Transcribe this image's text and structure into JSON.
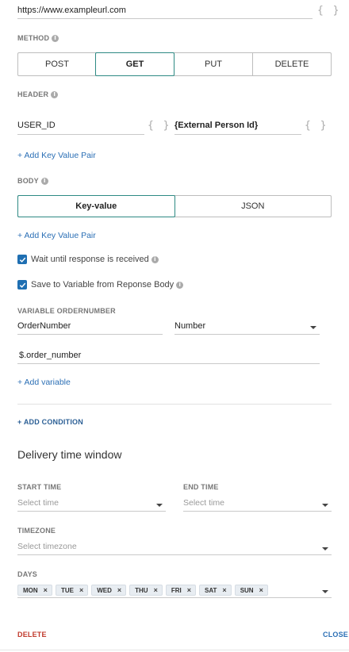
{
  "url": {
    "value": "https://www.exampleurl.com",
    "braces": "{ }"
  },
  "method": {
    "label": "METHOD",
    "info": "i",
    "options": [
      "POST",
      "GET",
      "PUT",
      "DELETE"
    ],
    "selected": "GET"
  },
  "header": {
    "label": "HEADER",
    "info": "i",
    "key": "USER_ID",
    "value": "{External Person Id}",
    "braces": "{ }",
    "add_label": "+ Add Key Value Pair"
  },
  "body": {
    "label": "BODY",
    "info": "i",
    "options": [
      "Key-value",
      "JSON"
    ],
    "selected": "Key-value",
    "add_label": "+ Add Key Value Pair"
  },
  "checkboxes": {
    "wait": {
      "label": "Wait until response is received",
      "checked": true
    },
    "save": {
      "label": "Save to Variable from Reponse Body",
      "checked": true
    }
  },
  "variable": {
    "label": "VARIABLE ORDERNUMBER",
    "name": "OrderNumber",
    "type": "Number",
    "path": "$.order_number",
    "add_label": "+ Add variable"
  },
  "add_condition": "+ ADD CONDITION",
  "delivery": {
    "title": "Delivery time window",
    "start_label": "START TIME",
    "start_placeholder": "Select time",
    "end_label": "END TIME",
    "end_placeholder": "Select time",
    "timezone_label": "TIMEZONE",
    "timezone_placeholder": "Select timezone",
    "days_label": "DAYS",
    "days": [
      "MON",
      "TUE",
      "WED",
      "THU",
      "FRI",
      "SAT",
      "SUN"
    ],
    "chip_remove": "×"
  },
  "footer": {
    "delete": "DELETE",
    "close": "CLOSE"
  },
  "colors": {
    "accent": "#2e8a84",
    "link": "#2b6fb5",
    "checkbox": "#1f6fb2",
    "delete": "#c0392b",
    "close": "#2b6fb5"
  },
  "icons": {
    "info": "info-circle-icon",
    "check": "check-icon",
    "caret": "caret-down-icon",
    "remove": "close-icon"
  }
}
